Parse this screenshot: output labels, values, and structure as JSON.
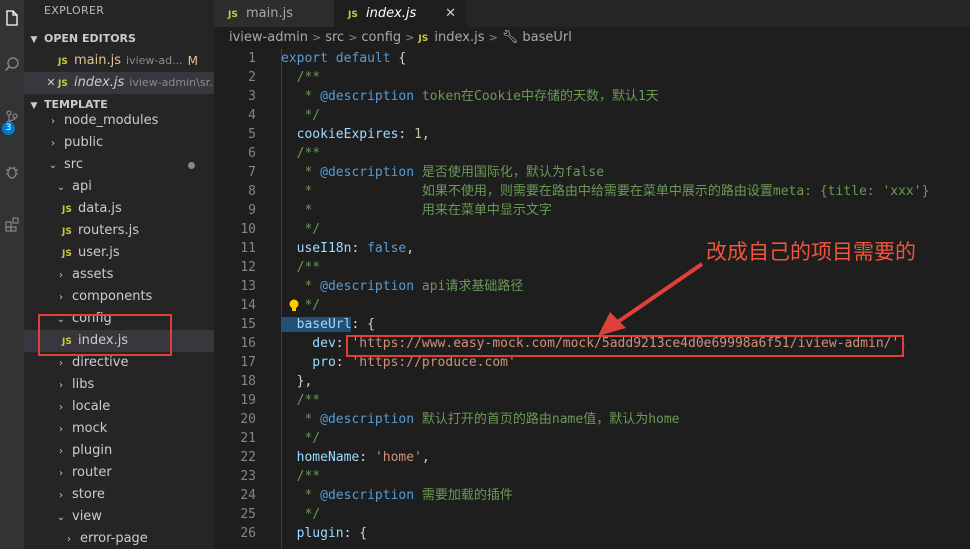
{
  "explorer": {
    "title": "EXPLORER",
    "open_editors_label": "OPEN EDITORS",
    "template_label": "TEMPLATE",
    "open_editors": [
      {
        "name": "main.js",
        "desc": "iview-ad...",
        "status": "M"
      },
      {
        "name": "index.js",
        "desc": "iview-admin\\sr..."
      }
    ],
    "tree": [
      {
        "label": "node_modules",
        "depth": 0,
        "chevron": ">"
      },
      {
        "label": "public",
        "depth": 0,
        "chevron": ">"
      },
      {
        "label": "src",
        "depth": 0,
        "chevron": "v"
      },
      {
        "label": "api",
        "depth": 1,
        "chevron": "v"
      },
      {
        "label": "data.js",
        "depth": 2,
        "file": true
      },
      {
        "label": "routers.js",
        "depth": 2,
        "file": true
      },
      {
        "label": "user.js",
        "depth": 2,
        "file": true
      },
      {
        "label": "assets",
        "depth": 1,
        "chevron": ">"
      },
      {
        "label": "components",
        "depth": 1,
        "chevron": ">"
      },
      {
        "label": "config",
        "depth": 1,
        "chevron": "v"
      },
      {
        "label": "index.js",
        "depth": 2,
        "file": true,
        "selected": true
      },
      {
        "label": "directive",
        "depth": 1,
        "chevron": ">"
      },
      {
        "label": "libs",
        "depth": 1,
        "chevron": ">"
      },
      {
        "label": "locale",
        "depth": 1,
        "chevron": ">"
      },
      {
        "label": "mock",
        "depth": 1,
        "chevron": ">"
      },
      {
        "label": "plugin",
        "depth": 1,
        "chevron": ">"
      },
      {
        "label": "router",
        "depth": 1,
        "chevron": ">"
      },
      {
        "label": "store",
        "depth": 1,
        "chevron": ">"
      },
      {
        "label": "view",
        "depth": 1,
        "chevron": "v"
      },
      {
        "label": "error-page",
        "depth": 2,
        "chevron": ">"
      }
    ]
  },
  "activity": {
    "badge": "3",
    "icons": [
      "files-icon",
      "search-icon",
      "source-control-icon",
      "debug-icon",
      "extensions-icon"
    ]
  },
  "tabs": [
    {
      "label": "main.js",
      "active": false
    },
    {
      "label": "index.js",
      "active": true,
      "close": "✕"
    }
  ],
  "file_badge": "JS",
  "breadcrumb": [
    "iview-admin",
    "src",
    "config",
    "index.js",
    "baseUrl"
  ],
  "code_lines": [
    [
      [
        "kw",
        "export"
      ],
      [
        "pl",
        " "
      ],
      [
        "kw",
        "default"
      ],
      [
        "pl",
        " {"
      ]
    ],
    [
      [
        "cm",
        "  /**"
      ]
    ],
    [
      [
        "cm",
        "   * "
      ],
      [
        "tg",
        "@description"
      ],
      [
        "cm",
        " token在Cookie中存储的天数，默认1天"
      ]
    ],
    [
      [
        "cm",
        "   */"
      ]
    ],
    [
      [
        "pr",
        "  cookieExpires"
      ],
      [
        "pl",
        ": "
      ],
      [
        "nm",
        "1"
      ],
      [
        "pl",
        ","
      ]
    ],
    [
      [
        "cm",
        "  /**"
      ]
    ],
    [
      [
        "cm",
        "   * "
      ],
      [
        "tg",
        "@description"
      ],
      [
        "cm",
        " 是否使用国际化，默认为false"
      ]
    ],
    [
      [
        "cm",
        "   *              如果不使用，则需要在路由中给需要在菜单中展示的路由设置meta: {title: 'xxx'}"
      ]
    ],
    [
      [
        "cm",
        "   *              用来在菜单中显示文字"
      ]
    ],
    [
      [
        "cm",
        "   */"
      ]
    ],
    [
      [
        "pr",
        "  useI18n"
      ],
      [
        "pl",
        ": "
      ],
      [
        "kw",
        "false"
      ],
      [
        "pl",
        ","
      ]
    ],
    [
      [
        "cm",
        "  /**"
      ]
    ],
    [
      [
        "cm",
        "   * "
      ],
      [
        "tg",
        "@description"
      ],
      [
        "cm",
        " api请求基础路径"
      ]
    ],
    [
      [
        "cm",
        "   */"
      ]
    ],
    [
      [
        "pr",
        "  baseUrl"
      ],
      [
        "pl",
        ": {"
      ]
    ],
    [
      [
        "pr",
        "    dev"
      ],
      [
        "pl",
        ": "
      ],
      [
        "st",
        "'https://www.easy-mock.com/mock/5add9213ce4d0e69998a6f51/iview-admin/'"
      ],
      [
        "pl",
        ","
      ]
    ],
    [
      [
        "pr",
        "    pro"
      ],
      [
        "pl",
        ": "
      ],
      [
        "st",
        "'https://produce.com'"
      ]
    ],
    [
      [
        "pl",
        "  },"
      ]
    ],
    [
      [
        "cm",
        "  /**"
      ]
    ],
    [
      [
        "cm",
        "   * "
      ],
      [
        "tg",
        "@description"
      ],
      [
        "cm",
        " 默认打开的首页的路由name值，默认为home"
      ]
    ],
    [
      [
        "cm",
        "   */"
      ]
    ],
    [
      [
        "pr",
        "  homeName"
      ],
      [
        "pl",
        ": "
      ],
      [
        "st",
        "'home'"
      ],
      [
        "pl",
        ","
      ]
    ],
    [
      [
        "cm",
        "  /**"
      ]
    ],
    [
      [
        "cm",
        "   * "
      ],
      [
        "tg",
        "@description"
      ],
      [
        "cm",
        " 需要加载的插件"
      ]
    ],
    [
      [
        "cm",
        "   */"
      ]
    ],
    [
      [
        "pr",
        "  plugin"
      ],
      [
        "pl",
        ": {"
      ]
    ]
  ],
  "line_numbers": [
    "1",
    "2",
    "3",
    "4",
    "5",
    "6",
    "7",
    "8",
    "9",
    "10",
    "11",
    "12",
    "13",
    "14",
    "15",
    "16",
    "17",
    "18",
    "19",
    "20",
    "21",
    "22",
    "23",
    "24",
    "25",
    "26"
  ],
  "annotation": {
    "text": "改成自己的项目需要的",
    "color": "#e0403a"
  }
}
